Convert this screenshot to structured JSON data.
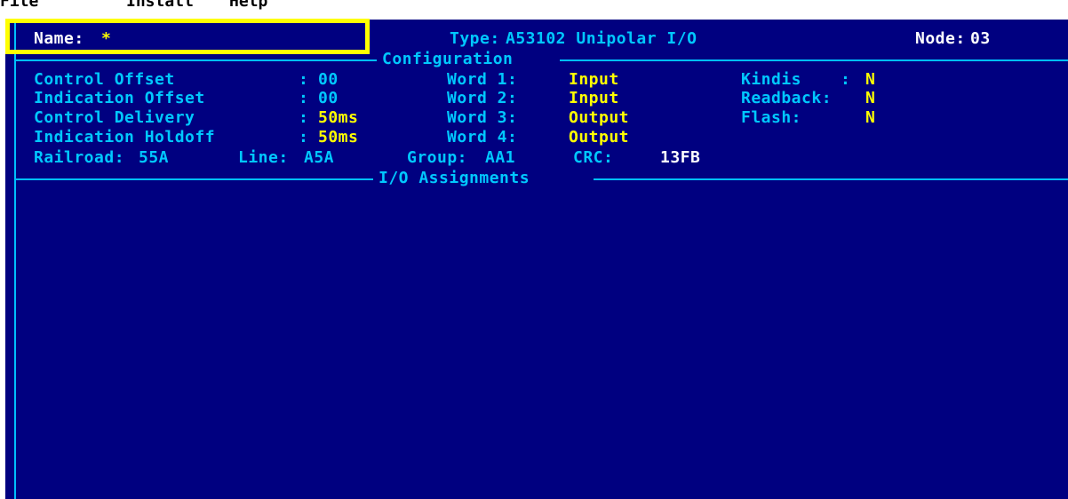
{
  "menu": {
    "items": [
      "File",
      "Install",
      "Help"
    ]
  },
  "header": {
    "name_label": "Name:",
    "name_value": "*",
    "type_label": "Type:",
    "type_value": "A53102 Unipolar I/O",
    "node_label": "Node:",
    "node_value": "03"
  },
  "sections": {
    "configuration": "Configuration",
    "io_assignments": "I/O Assignments"
  },
  "config": {
    "control_offset": {
      "label": "Control Offset",
      "value": "00"
    },
    "indication_offset": {
      "label": "Indication Offset",
      "value": "00"
    },
    "control_delivery": {
      "label": "Control Delivery",
      "value": "50ms"
    },
    "indication_holdoff": {
      "label": "Indication Holdoff",
      "value": "50ms"
    },
    "words": [
      {
        "label": "Word 1:",
        "value": "Input"
      },
      {
        "label": "Word 2:",
        "value": "Input"
      },
      {
        "label": "Word 3:",
        "value": "Output"
      },
      {
        "label": "Word 4:",
        "value": "Output"
      }
    ],
    "kindis": {
      "label": "Kindis",
      "value": "N"
    },
    "readback": {
      "label": "Readback:",
      "value": "N"
    },
    "flash": {
      "label": "Flash:",
      "value": "N"
    },
    "railroad": {
      "label": "Railroad:",
      "value": "55A"
    },
    "line": {
      "label": "Line:",
      "value": "A5A"
    },
    "group": {
      "label": "Group:",
      "value": "AA1"
    },
    "crc": {
      "label": "CRC:",
      "value": "13FB"
    },
    "colon": ":"
  },
  "colors": {
    "background": "#000080",
    "label": "#00c8ff",
    "value": "#ffff00",
    "highlight": "#ffff00"
  }
}
